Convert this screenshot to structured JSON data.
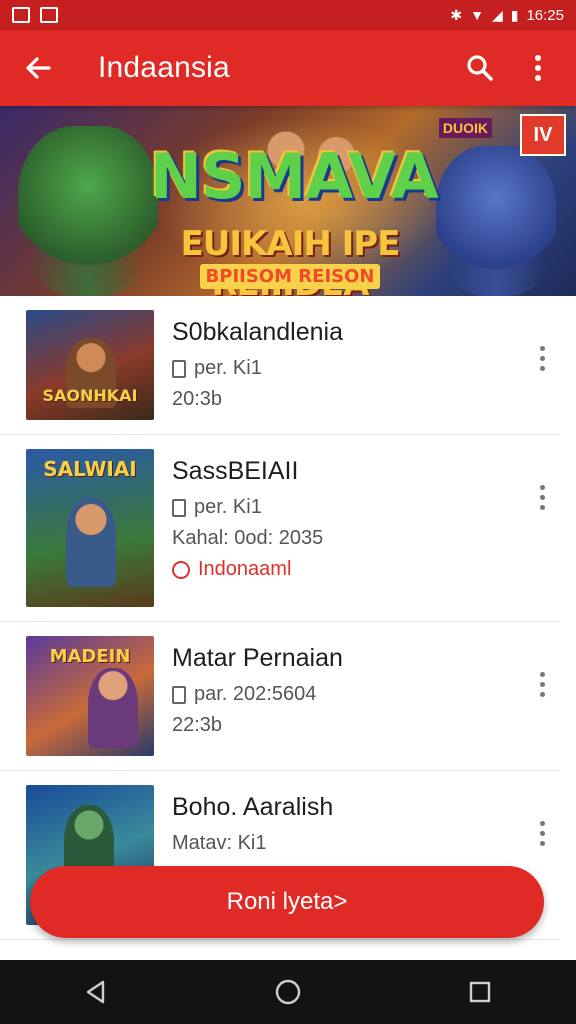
{
  "status_bar": {
    "time": "16:25",
    "icons": [
      "image-icon",
      "notification-icon",
      "bluetooth-icon",
      "wifi-icon",
      "signal-icon",
      "battery-icon"
    ]
  },
  "app_bar": {
    "title": "Indaansia",
    "icons": [
      "back-arrow-icon",
      "search-icon",
      "more-vert-icon"
    ]
  },
  "banner": {
    "headline": "NSMAVA",
    "subtitle": "EUIKAIH IPE REIIIDEA",
    "tagline": "BPIISOM REISON",
    "badge": "IV",
    "tag": "DUOIK"
  },
  "games": [
    {
      "title": "S0bkalandlenia",
      "detail": "per. Ki1",
      "extra": "20:3b",
      "thumb_caption": "SAONHKAI"
    },
    {
      "title": "SassBEIAII",
      "detail": "per. Ki1",
      "extra": "Kahal: 0od: 2035",
      "region": "Indonaaml",
      "thumb_caption": "SALWIAI"
    },
    {
      "title": "Matar Pernaian",
      "detail": "par. 202:5604",
      "extra": "22:3b",
      "thumb_caption": "MADEIN"
    },
    {
      "title": "Boho. Aaralish",
      "detail": "Matav: Ki1",
      "thumb_caption": ""
    }
  ],
  "cta_button": "Roni lyeta>",
  "colors": {
    "primary": "#e02a26",
    "status_bar": "#c51f1f",
    "nav_bar": "#131313"
  }
}
